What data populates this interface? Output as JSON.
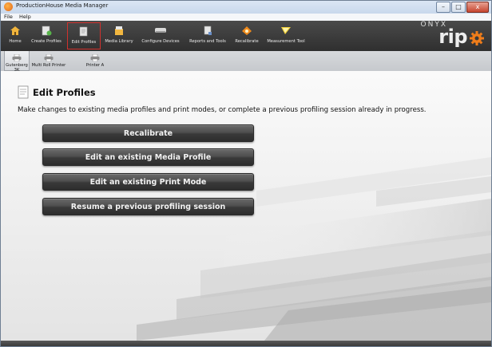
{
  "window": {
    "title": "ProductionHouse Media Manager"
  },
  "window_controls": {
    "minimize": "–",
    "maximize": "□",
    "close": "x"
  },
  "menu": {
    "items": [
      "File",
      "Help"
    ]
  },
  "toolbar": {
    "items": [
      {
        "label": "Home",
        "icon": "home-icon"
      },
      {
        "label": "Create Profiles",
        "icon": "create-profile-icon"
      },
      {
        "label": "Edit Profiles",
        "icon": "edit-profile-icon",
        "active": true
      },
      {
        "label": "Media Library",
        "icon": "media-library-icon"
      },
      {
        "label": "Configure Devices",
        "icon": "printer-device-icon"
      },
      {
        "label": "Reports and Tools",
        "icon": "reports-icon"
      },
      {
        "label": "Recalibrate",
        "icon": "recalibrate-icon"
      },
      {
        "label": "Measurement Tool",
        "icon": "measurement-icon"
      }
    ]
  },
  "brand": {
    "line1": "ONYX",
    "line2": "rip"
  },
  "printers": {
    "items": [
      {
        "label": "Gutenberg 3K",
        "active": true
      },
      {
        "label": "Multi Roll Printer"
      },
      {
        "label": "Printer A"
      }
    ]
  },
  "page": {
    "title": "Edit Profiles",
    "description": "Make changes to existing media profiles and print modes, or complete a previous profiling session already in progress."
  },
  "actions": {
    "recalibrate": "Recalibrate",
    "edit_media_profile": "Edit an existing Media Profile",
    "edit_print_mode": "Edit an existing Print Mode",
    "resume_session": "Resume a previous profiling session"
  },
  "colors": {
    "toolbar": "#3a3a3a",
    "active_outline": "#d0312d",
    "button": "#3c3c3c",
    "content_bg": "#f4f4f4"
  }
}
